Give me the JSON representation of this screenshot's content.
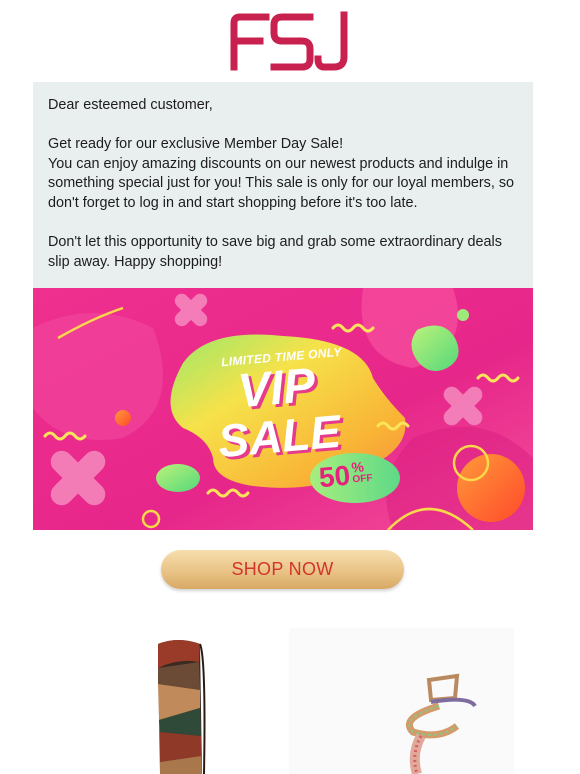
{
  "brand": {
    "logo_text": "FSJ",
    "logo_color": "#c8204f"
  },
  "message": {
    "greeting": "Dear esteemed customer,",
    "headline": "Get ready for our exclusive Member Day Sale!",
    "body": "You can enjoy amazing discounts on our newest products and indulge in something special just for you! This sale is only for our loyal members, so don't forget to log in and start shopping before it's too late.",
    "closing": "Don't let this opportunity to save big and grab some extraordinary deals slip away. Happy shopping!"
  },
  "banner": {
    "tagline": "LIMITED TIME ONLY",
    "line1": "VIP",
    "line2": "SALE",
    "discount_number": "50",
    "discount_percent": "%",
    "discount_off": "OFF",
    "colors": {
      "background": "#ee2f8e",
      "blob": "#f5d63b",
      "accent_green": "#7fe16d",
      "accent_orange": "#ff6a2d"
    }
  },
  "cta": {
    "label": "SHOP NOW",
    "text_color": "#d2352b"
  },
  "products": [
    {
      "name": "patchwork-leather-boot"
    },
    {
      "name": "rhinestone-spiral-sandal"
    }
  ]
}
